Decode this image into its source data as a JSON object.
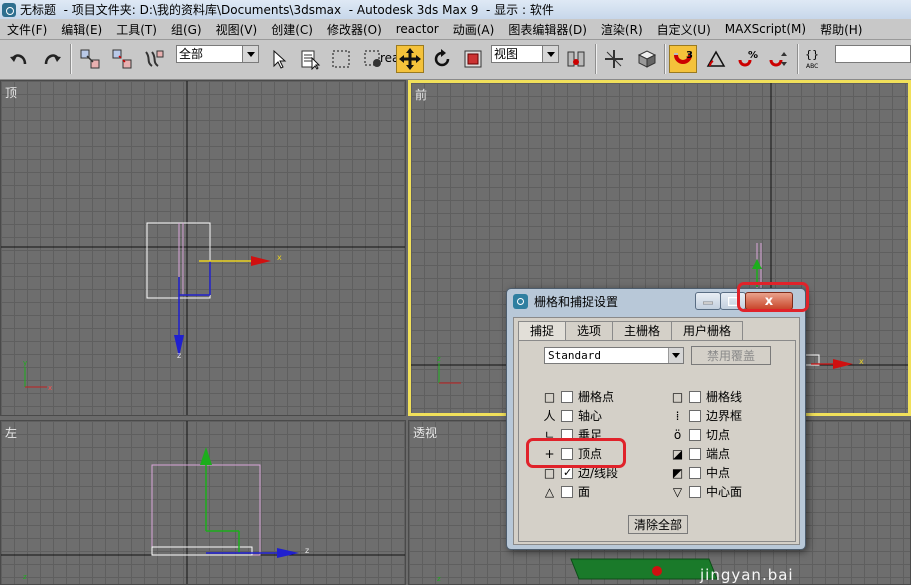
{
  "window": {
    "title_parts": [
      "无标题",
      "  - 项目文件夹: D:\\我的资料库\\Documents\\3dsmax",
      "  - Autodesk 3ds Max 9",
      "  - 显示 : 软件"
    ]
  },
  "menu": [
    "文件(F)",
    "编辑(E)",
    "工具(T)",
    "组(G)",
    "视图(V)",
    "创建(C)",
    "修改器(O)",
    "reactor",
    "动画(A)",
    "图表编辑器(D)",
    "渲染(R)",
    "自定义(U)",
    "MAXScript(M)",
    "帮助(H)"
  ],
  "toolbar": {
    "selection_filter": "全部",
    "reference_coord": "视图",
    "snap_toggle_badge": "3"
  },
  "viewports": {
    "top": "顶",
    "front": "前",
    "left": "左",
    "perspective": "透视"
  },
  "axes": {
    "x": "x",
    "y": "y",
    "z": "z"
  },
  "dialog": {
    "title": "栅格和捕捉设置",
    "tabs": [
      "捕捉",
      "选项",
      "主栅格",
      "用户栅格"
    ],
    "active_tab": 0,
    "snap_type": "Standard",
    "override_label": "禁用覆盖",
    "clear_all_label": "清除全部",
    "close_label": "x",
    "left_column": [
      {
        "icon": "grid-point-icon",
        "glyph": "□",
        "label": "栅格点",
        "checked": false
      },
      {
        "icon": "pivot-icon",
        "glyph": "人",
        "label": "轴心",
        "checked": false
      },
      {
        "icon": "perpendicular-icon",
        "glyph": "ㄴ",
        "label": "垂足",
        "checked": false
      },
      {
        "icon": "vertex-icon",
        "glyph": "+",
        "label": "顶点",
        "checked": false
      },
      {
        "icon": "edge-segment-icon",
        "glyph": "□",
        "label": "边/线段",
        "checked": true
      },
      {
        "icon": "face-icon",
        "glyph": "△",
        "label": "面",
        "checked": false
      }
    ],
    "right_column": [
      {
        "icon": "grid-line-icon",
        "glyph": "□",
        "label": "栅格线",
        "checked": false
      },
      {
        "icon": "bounding-box-icon",
        "glyph": "⁞",
        "label": "边界框",
        "checked": false
      },
      {
        "icon": "tangent-icon",
        "glyph": "ö",
        "label": "切点",
        "checked": false
      },
      {
        "icon": "endpoint-icon",
        "glyph": "◪",
        "label": "端点",
        "checked": false
      },
      {
        "icon": "midpoint-icon",
        "glyph": "◩",
        "label": "中点",
        "checked": false
      },
      {
        "icon": "center-face-icon",
        "glyph": "▽",
        "label": "中心面",
        "checked": false
      }
    ]
  },
  "watermark": "jingyan.bai"
}
